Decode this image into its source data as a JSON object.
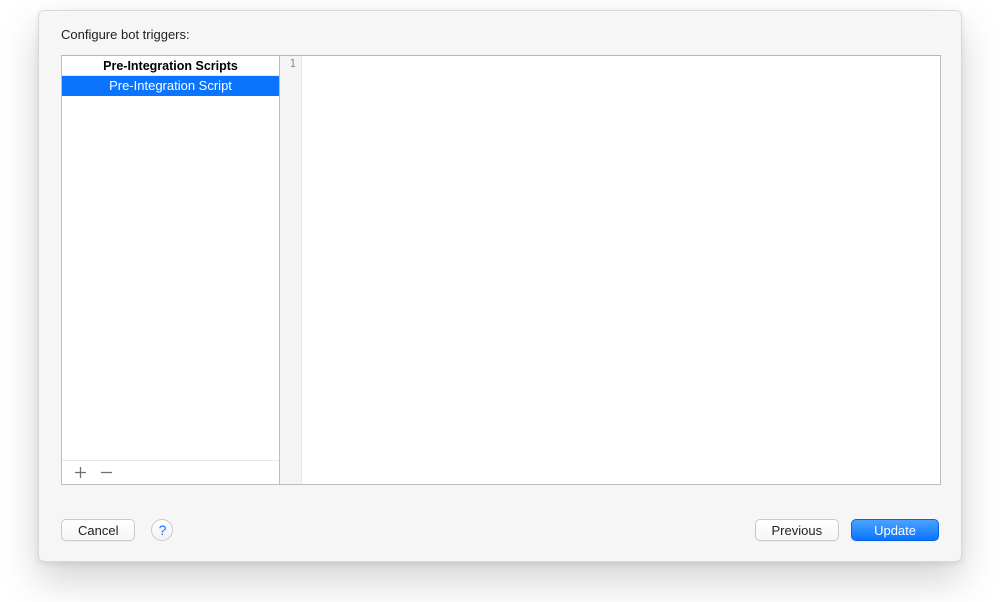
{
  "heading": "Configure bot triggers:",
  "sidebar": {
    "section_header": "Pre-Integration Scripts",
    "items": [
      {
        "label": "Pre-Integration Script",
        "selected": true
      }
    ]
  },
  "editor": {
    "gutter_lines": [
      "1"
    ],
    "content": ""
  },
  "buttons": {
    "cancel": "Cancel",
    "help": "?",
    "previous": "Previous",
    "update": "Update"
  }
}
